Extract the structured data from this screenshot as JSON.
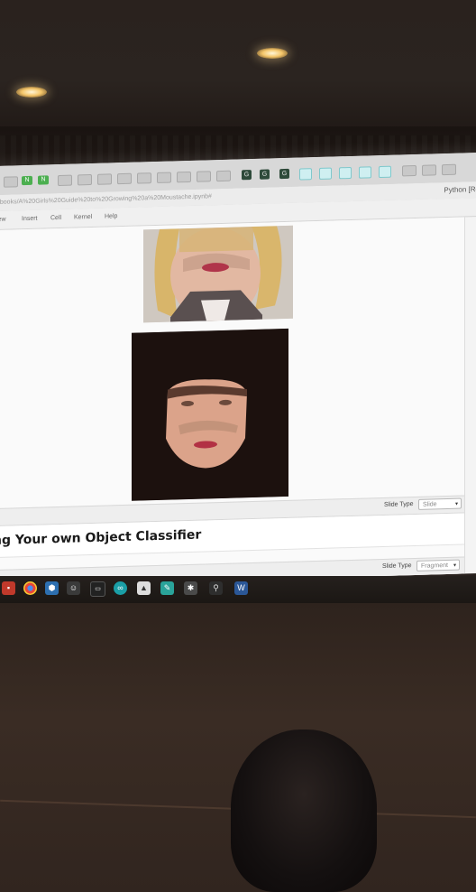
{
  "browser": {
    "url": "ebooks/A%20Girls%20Guide%20to%20Growing%20a%20Moustache.ipynb#",
    "kernel_indicator": "Python [Ro",
    "tab_labels": [
      "N",
      "N",
      "G",
      "G",
      "G"
    ]
  },
  "notebook": {
    "menu": [
      "iew",
      "Insert",
      "Cell",
      "Kernel",
      "Help"
    ],
    "slide_toolbar_1": {
      "label": "Slide Type",
      "value": "Slide"
    },
    "heading": "ng Your own Object Classifier",
    "slide_toolbar_2": {
      "label": "Slide Type",
      "value": "Fragment"
    }
  },
  "images": [
    {
      "name": "face-blonde-moustache",
      "background": "#cfcac3"
    },
    {
      "name": "face-mask-black-background",
      "background": "#1a100d"
    }
  ],
  "taskbar": {
    "icons": [
      "app-icon",
      "chrome-icon",
      "network-icon",
      "person-icon",
      "terminal-icon",
      "arduino-icon",
      "photos-icon",
      "notepad-icon",
      "tool-icon",
      "magnifier-icon",
      "word-icon"
    ]
  },
  "colors": {
    "screen_bg": "#f4f4f4",
    "room_dark": "#1c1410",
    "tab_green": "#4caf50"
  }
}
